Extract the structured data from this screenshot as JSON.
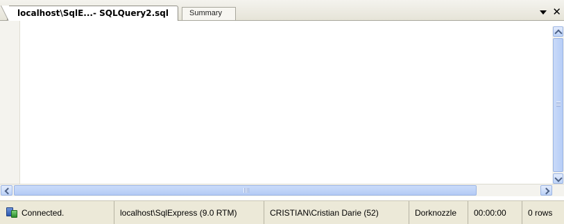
{
  "tabs": [
    {
      "label": "localhost\\SqlE...- SQLQuery2.sql",
      "active": true
    },
    {
      "label": "Summary",
      "active": false
    }
  ],
  "window_controls": {
    "dropdown_icon": "dropdown-arrow-icon",
    "close_icon": "close-icon",
    "close_glyph": "✕"
  },
  "status": {
    "connection": "Connected.",
    "server": "localhost\\SqlExpress (9.0 RTM)",
    "user": "CRISTIAN\\Cristian Darie (52)",
    "database": "Dorknozzle",
    "elapsed": "00:00:00",
    "rows": "0 rows"
  },
  "colors": {
    "accent": "#b6cdf7",
    "status_bg": "#ece9d8"
  }
}
